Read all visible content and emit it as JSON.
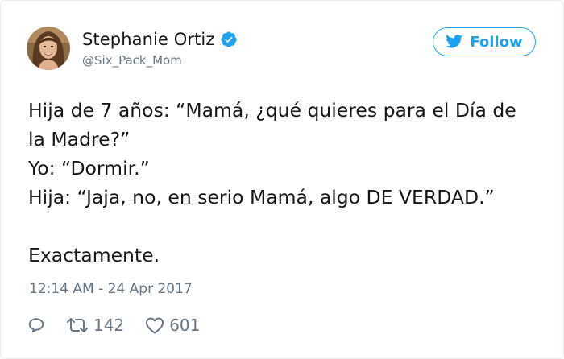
{
  "tweet": {
    "author": {
      "display_name": "Stephanie Ortiz",
      "handle": "@Six_Pack_Mom",
      "verified_icon": "verified-badge-icon",
      "avatar_icon": "profile-avatar"
    },
    "follow_button": {
      "label": "Follow",
      "icon": "twitter-bird-icon"
    },
    "text_lines": [
      "Hija de 7 años: “Mamá, ¿qué quieres para el Día de",
      "la Madre?”",
      "Yo: “Dormir.”",
      "Hija: “Jaja, no, en serio Mamá, algo DE VERDAD.”",
      "",
      "Exactamente."
    ],
    "timestamp": "12:14 AM - 24 Apr 2017",
    "actions": {
      "reply": {
        "icon": "reply-icon",
        "count": ""
      },
      "retweet": {
        "icon": "retweet-icon",
        "count": "142"
      },
      "like": {
        "icon": "heart-icon",
        "count": "601"
      }
    },
    "colors": {
      "accent": "#1da1f2",
      "text": "#14171a",
      "muted": "#657786",
      "border": "#e6ecf0"
    }
  }
}
